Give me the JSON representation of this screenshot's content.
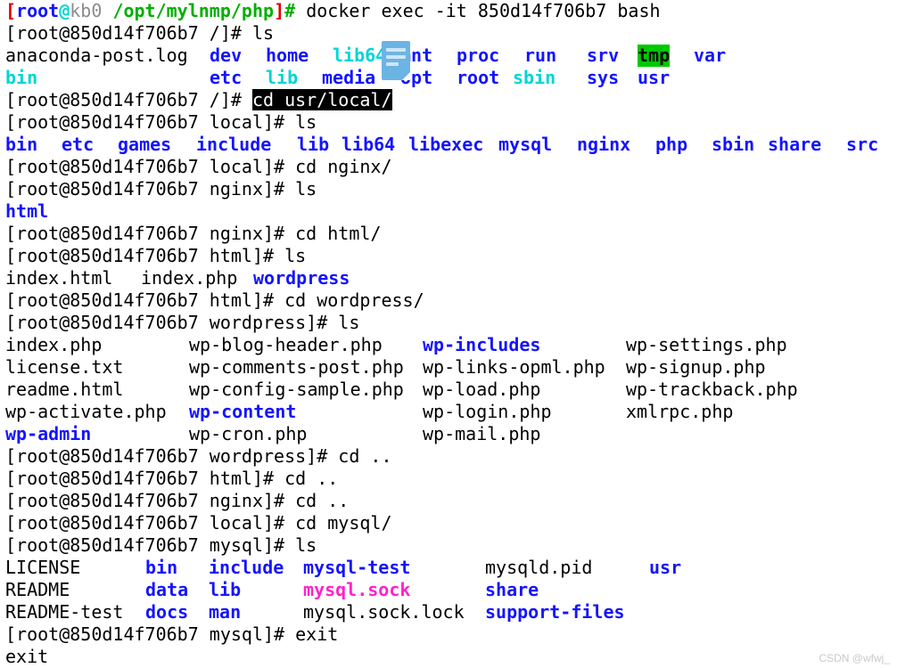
{
  "terminal": {
    "background": "#ffffff",
    "foreground": "#000000",
    "colors": {
      "red": "#e00000",
      "green": "#00b000",
      "blue": "#1414ff",
      "cyan": "#00d5d5",
      "magenta": "#ff22cc",
      "grey": "#8c8c8c",
      "tmp_highlight_bg": "#00c800",
      "selection_bg": "#000000",
      "selection_fg": "#ffffff"
    },
    "host_prompt": {
      "bracket_open": "[",
      "user": "root",
      "at": "@",
      "host": "kb0",
      "cwd": "/opt/mylnmp/php",
      "bracket_close": "]",
      "hash": "#"
    },
    "container_prompts": {
      "root": "[root@850d14f706b7 /]# ",
      "local": "[root@850d14f706b7 local]# ",
      "nginx": "[root@850d14f706b7 nginx]# ",
      "html": "[root@850d14f706b7 html]# ",
      "wordpress": "[root@850d14f706b7 wordpress]# ",
      "mysql": "[root@850d14f706b7 mysql]# "
    },
    "commands": {
      "docker_exec": "docker exec -it 850d14f706b7 bash",
      "ls": "ls",
      "cd_usr_local": "cd usr/local/",
      "cd_nginx": "cd nginx/",
      "cd_html": "cd html/",
      "cd_wordpress": "cd wordpress/",
      "cd_up": "cd ..",
      "cd_mysql": "cd mysql/",
      "exit": "exit",
      "exit_echo": "exit"
    },
    "ls_root": {
      "col1": [
        {
          "text": "anaconda-post.log",
          "color": "c-black"
        },
        {
          "text": "bin",
          "color": "c-cyan"
        }
      ],
      "col2": [
        {
          "text": "dev",
          "color": "c-blue"
        },
        {
          "text": "etc",
          "color": "c-blue"
        }
      ],
      "col3": [
        {
          "text": "home",
          "color": "c-blue"
        },
        {
          "text": "lib",
          "color": "c-cyan"
        }
      ],
      "col4": [
        {
          "text": "lib64",
          "color": "c-cyan"
        },
        {
          "text": "media",
          "color": "c-blue"
        }
      ],
      "col5": [
        {
          "text": "mnt",
          "color": "c-blue"
        },
        {
          "text": "opt",
          "color": "c-blue"
        }
      ],
      "col6": [
        {
          "text": "proc",
          "color": "c-blue"
        },
        {
          "text": "root",
          "color": "c-blue"
        }
      ],
      "col7": [
        {
          "text": "run",
          "color": "c-blue"
        },
        {
          "text": "sbin",
          "color": "c-cyan"
        }
      ],
      "col8": [
        {
          "text": "srv",
          "color": "c-blue"
        },
        {
          "text": "sys",
          "color": "c-blue"
        }
      ],
      "col9": [
        {
          "text": "tmp",
          "color": "bg-green"
        },
        {
          "text": "usr",
          "color": "c-blue"
        }
      ],
      "col10": [
        {
          "text": "var",
          "color": "c-blue"
        },
        {
          "text": "",
          "color": "c-black"
        }
      ]
    },
    "ls_usr_local": [
      "bin",
      "etc",
      "games",
      "include",
      "lib",
      "lib64",
      "libexec",
      "mysql",
      "nginx",
      "php",
      "sbin",
      "share",
      "src"
    ],
    "ls_nginx": [
      "html"
    ],
    "ls_html": [
      {
        "text": "index.html",
        "color": "c-black"
      },
      {
        "text": "index.php",
        "color": "c-black"
      },
      {
        "text": "wordpress",
        "color": "c-blue"
      }
    ],
    "ls_wordpress": {
      "col1": [
        {
          "text": "index.php",
          "color": "c-black"
        },
        {
          "text": "license.txt",
          "color": "c-black"
        },
        {
          "text": "readme.html",
          "color": "c-black"
        },
        {
          "text": "wp-activate.php",
          "color": "c-black"
        },
        {
          "text": "wp-admin",
          "color": "c-blue"
        }
      ],
      "col2": [
        {
          "text": "wp-blog-header.php",
          "color": "c-black"
        },
        {
          "text": "wp-comments-post.php",
          "color": "c-black"
        },
        {
          "text": "wp-config-sample.php",
          "color": "c-black"
        },
        {
          "text": "wp-content",
          "color": "c-blue"
        },
        {
          "text": "wp-cron.php",
          "color": "c-black"
        }
      ],
      "col3": [
        {
          "text": "wp-includes",
          "color": "c-blue"
        },
        {
          "text": "wp-links-opml.php",
          "color": "c-black"
        },
        {
          "text": "wp-load.php",
          "color": "c-black"
        },
        {
          "text": "wp-login.php",
          "color": "c-black"
        },
        {
          "text": "wp-mail.php",
          "color": "c-black"
        }
      ],
      "col4": [
        {
          "text": "wp-settings.php",
          "color": "c-black"
        },
        {
          "text": "wp-signup.php",
          "color": "c-black"
        },
        {
          "text": "wp-trackback.php",
          "color": "c-black"
        },
        {
          "text": "xmlrpc.php",
          "color": "c-black"
        },
        {
          "text": "",
          "color": "c-black"
        }
      ]
    },
    "ls_mysql": {
      "col1": [
        {
          "text": "LICENSE",
          "color": "c-black"
        },
        {
          "text": "README",
          "color": "c-black"
        },
        {
          "text": "README-test",
          "color": "c-black"
        }
      ],
      "col2": [
        {
          "text": "bin",
          "color": "c-blue"
        },
        {
          "text": "data",
          "color": "c-blue"
        },
        {
          "text": "docs",
          "color": "c-blue"
        }
      ],
      "col3": [
        {
          "text": "include",
          "color": "c-blue"
        },
        {
          "text": "lib",
          "color": "c-blue"
        },
        {
          "text": "man",
          "color": "c-blue"
        }
      ],
      "col4": [
        {
          "text": "mysql-test",
          "color": "c-blue"
        },
        {
          "text": "mysql.sock",
          "color": "c-magenta"
        },
        {
          "text": "mysql.sock.lock",
          "color": "c-black"
        }
      ],
      "col5": [
        {
          "text": "mysqld.pid",
          "color": "c-black"
        },
        {
          "text": "share",
          "color": "c-blue"
        },
        {
          "text": "support-files",
          "color": "c-blue"
        }
      ],
      "col6": [
        {
          "text": "usr",
          "color": "c-blue"
        },
        {
          "text": "",
          "color": "c-black"
        },
        {
          "text": "",
          "color": "c-black"
        }
      ]
    }
  },
  "overlay": {
    "doc_icon_name": "document-icon",
    "watermark": "CSDN @wfwj_"
  }
}
